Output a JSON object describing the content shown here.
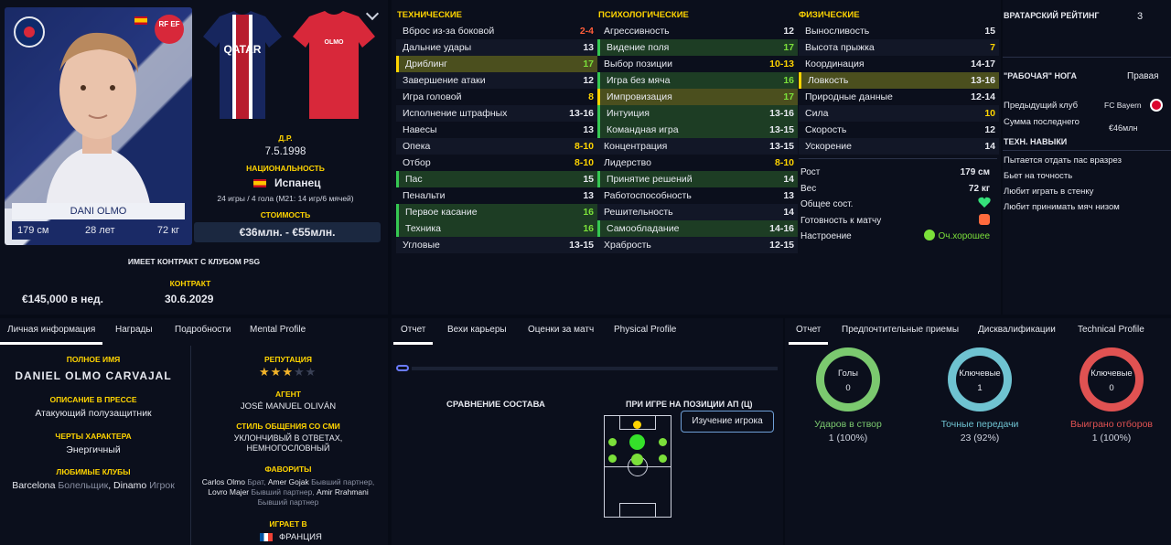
{
  "player": {
    "name": "DANI OLMO",
    "height": "179 см",
    "age": "28 лет",
    "weight": "72 кг"
  },
  "bio": {
    "dob_label": "Д.Р.",
    "dob": "7.5.1998",
    "nat_label": "НАЦИОНАЛЬНОСТЬ",
    "nationality": "Испанец",
    "caps": "24 игры / 4 гола (М21: 14 игр/6 мячей)",
    "value_label": "СТОИМОСТЬ",
    "value": "€36млн. - €55млн."
  },
  "contract": {
    "club_text": "ИМЕЕТ КОНТРАКТ С КЛУБОМ PSG",
    "label": "КОНТРАКТ",
    "wage": "€145,000 в нед.",
    "expiry": "30.6.2029"
  },
  "kit": {
    "away_name": "OLMO",
    "sponsor": "QATAR AIRWAYS"
  },
  "badges": {
    "fed": "RF EF"
  },
  "technical": {
    "header": "ТЕХНИЧЕСКИЕ",
    "rows": [
      {
        "n": "Вброс из-за боковой",
        "v": "2-4",
        "c": "#ff5d3a",
        "h": ""
      },
      {
        "n": "Дальние удары",
        "v": "13",
        "c": "#e6e8ef",
        "h": ""
      },
      {
        "n": "Дриблинг",
        "v": "17",
        "c": "#7be03a",
        "h": "hl"
      },
      {
        "n": "Завершение атаки",
        "v": "12",
        "c": "#e6e8ef",
        "h": ""
      },
      {
        "n": "Игра головой",
        "v": "8",
        "c": "#ffd400",
        "h": ""
      },
      {
        "n": "Исполнение штрафных",
        "v": "13-16",
        "c": "#e6e8ef",
        "h": ""
      },
      {
        "n": "Навесы",
        "v": "13",
        "c": "#e6e8ef",
        "h": ""
      },
      {
        "n": "Опека",
        "v": "8-10",
        "c": "#ffd400",
        "h": ""
      },
      {
        "n": "Отбор",
        "v": "8-10",
        "c": "#ffd400",
        "h": ""
      },
      {
        "n": "Пас",
        "v": "15",
        "c": "#e6e8ef",
        "h": "hlg"
      },
      {
        "n": "Пенальти",
        "v": "13",
        "c": "#e6e8ef",
        "h": ""
      },
      {
        "n": "Первое касание",
        "v": "16",
        "c": "#7be03a",
        "h": "hlg"
      },
      {
        "n": "Техника",
        "v": "16",
        "c": "#7be03a",
        "h": "hlg"
      },
      {
        "n": "Угловые",
        "v": "13-15",
        "c": "#e6e8ef",
        "h": ""
      }
    ]
  },
  "mental": {
    "header": "ПСИХОЛОГИЧЕСКИЕ",
    "rows": [
      {
        "n": "Агрессивность",
        "v": "12",
        "c": "#e6e8ef",
        "h": ""
      },
      {
        "n": "Видение поля",
        "v": "17",
        "c": "#7be03a",
        "h": "hlg"
      },
      {
        "n": "Выбор позиции",
        "v": "10-13",
        "c": "#ffd400",
        "h": ""
      },
      {
        "n": "Игра без мяча",
        "v": "16",
        "c": "#7be03a",
        "h": "hlg"
      },
      {
        "n": "Импровизация",
        "v": "17",
        "c": "#7be03a",
        "h": "hl"
      },
      {
        "n": "Интуиция",
        "v": "13-16",
        "c": "#e6e8ef",
        "h": "hlg"
      },
      {
        "n": "Командная игра",
        "v": "13-15",
        "c": "#e6e8ef",
        "h": "hlg"
      },
      {
        "n": "Концентрация",
        "v": "13-15",
        "c": "#e6e8ef",
        "h": ""
      },
      {
        "n": "Лидерство",
        "v": "8-10",
        "c": "#ffd400",
        "h": ""
      },
      {
        "n": "Принятие решений",
        "v": "14",
        "c": "#e6e8ef",
        "h": "hlg"
      },
      {
        "n": "Работоспособность",
        "v": "13",
        "c": "#e6e8ef",
        "h": ""
      },
      {
        "n": "Решительность",
        "v": "14",
        "c": "#e6e8ef",
        "h": ""
      },
      {
        "n": "Самообладание",
        "v": "14-16",
        "c": "#e6e8ef",
        "h": "hlg"
      },
      {
        "n": "Храбрость",
        "v": "12-15",
        "c": "#e6e8ef",
        "h": ""
      }
    ]
  },
  "physical": {
    "header": "ФИЗИЧЕСКИЕ",
    "rows": [
      {
        "n": "Выносливость",
        "v": "15",
        "c": "#e6e8ef",
        "h": ""
      },
      {
        "n": "Высота прыжка",
        "v": "7",
        "c": "#ffd400",
        "h": ""
      },
      {
        "n": "Координация",
        "v": "14-17",
        "c": "#e6e8ef",
        "h": ""
      },
      {
        "n": "Ловкость",
        "v": "13-16",
        "c": "#e6e8ef",
        "h": "hl"
      },
      {
        "n": "Природные данные",
        "v": "12-14",
        "c": "#e6e8ef",
        "h": ""
      },
      {
        "n": "Сила",
        "v": "10",
        "c": "#ffd400",
        "h": ""
      },
      {
        "n": "Скорость",
        "v": "12",
        "c": "#e6e8ef",
        "h": ""
      },
      {
        "n": "Ускорение",
        "v": "14",
        "c": "#e6e8ef",
        "h": ""
      }
    ]
  },
  "phys_info": [
    {
      "n": "Рост",
      "v": "179 см"
    },
    {
      "n": "Вес",
      "v": "72 кг"
    },
    {
      "n": "Общее сост.",
      "v": ""
    },
    {
      "n": "Готовность к матчу",
      "v": ""
    },
    {
      "n": "Настроение",
      "v": "Оч.хорошее"
    }
  ],
  "right_info": {
    "gk_label": "ВРАТАРСКИЙ РЕЙТИНГ",
    "gk_value": "3",
    "foot_label": "\"РАБОЧАЯ\" НОГА",
    "foot_value": "Правая",
    "prev_club_label": "Предыдущий клуб",
    "prev_club": "FC Bayern",
    "fee_label": "Сумма последнего",
    "fee": "€46млн",
    "skills_header": "ТЕХН. НАВЫКИ",
    "skills": [
      "Пытается отдать пас вразрез",
      "Бьет на точность",
      "Любит играть в стенку",
      "Любит принимать мяч низом"
    ]
  },
  "info_tabs": [
    "Личная информация",
    "Награды",
    "Подробности",
    "Mental Profile"
  ],
  "personal": {
    "fullname_label": "ПОЛНОЕ ИМЯ",
    "fullname": "DANIEL OLMO CARVAJAL",
    "press_label": "ОПИСАНИЕ В ПРЕССЕ",
    "press": "Атакующий полузащитник",
    "traits_label": "ЧЕРТЫ ХАРАКТЕРА",
    "traits": "Энергичный",
    "clubs_label": "ЛЮБИМЫЕ КЛУБЫ",
    "club1": "Barcelona",
    "club1_role": "Болельщик",
    "sep": ",",
    "club2": "Dinamo",
    "club2_role": "Игрок",
    "rep_label": "РЕПУТАЦИЯ",
    "rep_stars": 3,
    "rep_stars_max": 5,
    "agent_label": "АГЕНТ",
    "agent": "JOSÉ MANUEL OLIVÁN",
    "media_label": "СТИЛЬ ОБЩЕНИЯ СО СМИ",
    "media": "УКЛОНЧИВЫЙ В ОТВЕТАХ, НЕМНОГОСЛОВНЫЙ",
    "fav_label": "ФАВОРИТЫ",
    "fav_line1_a": "Carlos Olmo",
    "fav_line1_b": "Брат,",
    "fav_line1_c": "Amer Gojak",
    "fav_line1_d": "Бывший партнер,",
    "fav_line2_a": "Lovro Majer",
    "fav_line2_b": "Бывший партнер,",
    "fav_line2_c": "Amir Rrahmani",
    "fav_line3": "Бывший партнер",
    "plays_label": "ИГРАЕТ В",
    "plays": "ФРАНЦИЯ"
  },
  "report_tabs": [
    "Отчет",
    "Вехи карьеры",
    "Оценки за матч",
    "Physical Profile"
  ],
  "report": {
    "squad_compare": "СРАВНЕНИЕ СОСТАВА",
    "position_title": "ПРИ ИГРЕ НА ПОЗИЦИИ АП (Ц)",
    "study_button": "Изучение игрока"
  },
  "stats_tabs": [
    "Отчет",
    "Предпочтительные приемы",
    "Дисквалификации",
    "Technical Profile"
  ],
  "rings": [
    {
      "label": "Голы",
      "value": "0",
      "caption": "Ударов в створ",
      "sub": "1 (100%)",
      "color": "#7bc96f"
    },
    {
      "label": "Ключевые",
      "value": "1",
      "caption": "Точные передачи",
      "sub": "23 (92%)",
      "color": "#6fc3d1"
    },
    {
      "label": "Ключевые",
      "value": "0",
      "caption": "Выиграно отборов",
      "sub": "1 (100%)",
      "color": "#e05252"
    }
  ]
}
